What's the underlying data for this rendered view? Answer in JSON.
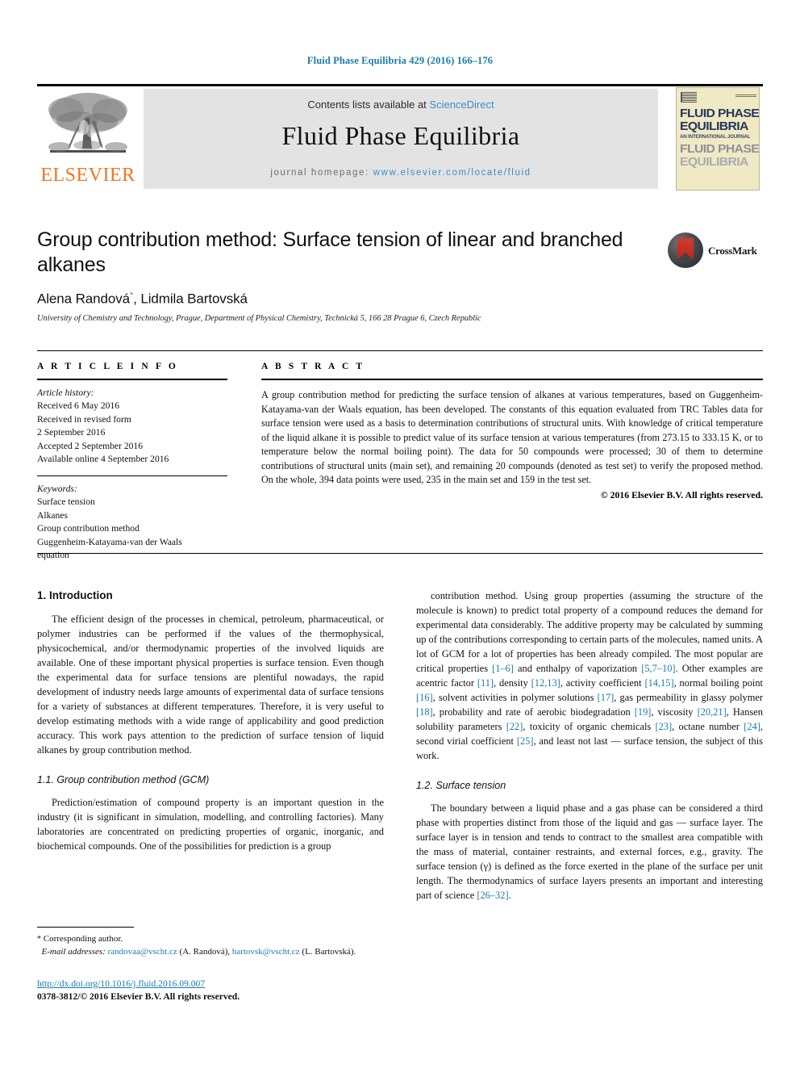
{
  "running_head": "Fluid Phase Equilibria 429 (2016) 166–176",
  "masthead": {
    "publisher_name": "ELSEVIER",
    "contents_prefix": "Contents lists available at ",
    "contents_link": "ScienceDirect",
    "journal_name": "Fluid Phase Equilibria",
    "homepage_prefix": "journal homepage: ",
    "homepage_url": "www.elsevier.com/locate/fluid",
    "cover": {
      "line1": "FLUID PHASE",
      "line2": "EQUILIBRIA",
      "subtitle": "AN INTERNATIONAL JOURNAL",
      "line3": "FLUID PHASE",
      "line4": "EQUILIBRIA"
    }
  },
  "article": {
    "title": "Group contribution method: Surface tension of linear and branched alkanes",
    "authors": "Alena Randová",
    "authors_rest": ", Lidmila Bartovská",
    "corresponding_marker": "*",
    "affiliation": "University of Chemistry and Technology, Prague, Department of Physical Chemistry, Technická 5, 166 28 Prague 6, Czech Republic",
    "crossmark_label": "CrossMark"
  },
  "article_info": {
    "heading": "A R T I C L E   I N F O",
    "history_label": "Article history:",
    "history": [
      "Received 6 May 2016",
      "Received in revised form",
      "2 September 2016",
      "Accepted 2 September 2016",
      "Available online 4 September 2016"
    ],
    "keywords_label": "Keywords:",
    "keywords": [
      "Surface tension",
      "Alkanes",
      "Group contribution method",
      "Guggenheim-Katayama-van der Waals",
      "equation"
    ]
  },
  "abstract": {
    "heading": "A B S T R A C T",
    "text": "A group contribution method for predicting the surface tension of alkanes at various temperatures, based on Guggenheim-Katayama-van der Waals equation, has been developed. The constants of this equation evaluated from TRC Tables data for surface tension were used as a basis to determination contributions of structural units. With knowledge of critical temperature of the liquid alkane it is possible to predict value of its surface tension at various temperatures (from 273.15 to 333.15 K, or to temperature below the normal boiling point). The data for 50 compounds were processed; 30 of them to determine contributions of structural units (main set), and remaining 20 compounds (denoted as test set) to verify the proposed method. On the whole, 394 data points were used, 235 in the main set and 159 in the test set.",
    "copyright": "© 2016 Elsevier B.V. All rights reserved."
  },
  "body": {
    "left": {
      "section_title": "1. Introduction",
      "para1": "The efficient design of the processes in chemical, petroleum, pharmaceutical, or polymer industries can be performed if the values of the thermophysical, physicochemical, and/or thermodynamic properties of the involved liquids are available. One of these important physical properties is surface tension. Even though the experimental data for surface tensions are plentiful nowadays, the rapid development of industry needs large amounts of experimental data of surface tensions for a variety of substances at different temperatures. Therefore, it is very useful to develop estimating methods with a wide range of applicability and good prediction accuracy. This work pays attention to the prediction of surface tension of liquid alkanes by group contribution method.",
      "subsection_title": "1.1. Group contribution method (GCM)",
      "para2": "Prediction/estimation of compound property is an important question in the industry (it is significant in simulation, modelling, and controlling factories). Many laboratories are concentrated on predicting properties of organic, inorganic, and biochemical compounds. One of the possibilities for prediction is a group"
    },
    "right": {
      "para1_a": "contribution method. Using group properties (assuming the structure of the molecule is known) to predict total property of a compound reduces the demand for experimental data considerably. The additive property may be calculated by summing up of the contributions corresponding to certain parts of the molecules, named units. A lot of GCM for a lot of properties has been already compiled. The most popular are critical properties ",
      "ref1": "[1–6]",
      "para1_b": " and enthalpy of vaporization ",
      "ref2": "[5,7–10]",
      "para1_c": ". Other examples are acentric factor ",
      "ref3": "[11]",
      "para1_d": ", density ",
      "ref4": "[12,13]",
      "para1_e": ", activity coefficient ",
      "ref5": "[14,15]",
      "para1_f": ", normal boiling point ",
      "ref6": "[16]",
      "para1_g": ", solvent activities in polymer solutions ",
      "ref7": "[17]",
      "para1_h": ", gas permeability in glassy polymer ",
      "ref8": "[18]",
      "para1_i": ", probability and rate of aerobic biodegradation ",
      "ref9": "[19]",
      "para1_j": ", viscosity ",
      "ref10": "[20,21]",
      "para1_k": ", Hansen solubility parameters ",
      "ref11": "[22]",
      "para1_l": ", toxicity of organic chemicals ",
      "ref12": "[23]",
      "para1_m": ", octane number ",
      "ref13": "[24]",
      "para1_n": ", second virial coefficient ",
      "ref14": "[25]",
      "para1_o": ", and least not last — surface tension, the subject of this work.",
      "subsection_title": "1.2. Surface tension",
      "para2_a": "The boundary between a liquid phase and a gas phase can be considered a third phase with properties distinct from those of the liquid and gas — surface layer. The surface layer is in tension and tends to contract to the smallest area compatible with the mass of material, container restraints, and external forces, e.g., gravity. The surface tension (γ) is defined as the force exerted in the plane of the surface per unit length. The thermodynamics of surface layers presents an important and interesting part of science ",
      "ref15": "[26–32]",
      "para2_b": "."
    }
  },
  "footnote": {
    "star": "*",
    "corresponding": " Corresponding author.",
    "email_label": "E-mail addresses:",
    "email1": "randovaa@vscht.cz",
    "email1_owner": " (A. Randová), ",
    "email2": "bartovsk@vscht.cz",
    "email2_owner": "(L. Bartovská)."
  },
  "footer": {
    "doi": "http://dx.doi.org/10.1016/j.fluid.2016.09.007",
    "issn": "0378-3812/© 2016 Elsevier B.V. All rights reserved."
  },
  "colors": {
    "link_blue": "#1a7bad",
    "elsevier_orange": "#ee7623",
    "banner_gray": "#e3e3e3",
    "cover_cream": "#efe9c4",
    "cover_navy": "#26375e"
  }
}
